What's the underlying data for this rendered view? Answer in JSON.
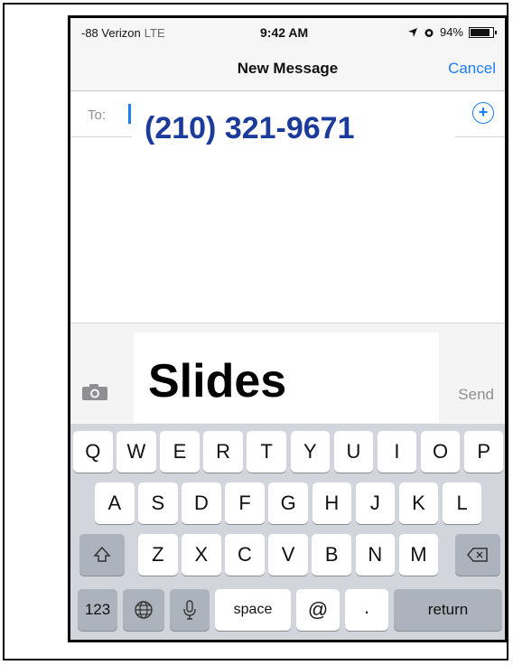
{
  "status": {
    "carrier": "-88 Verizon",
    "network": "LTE",
    "time": "9:42 AM",
    "battery": "94%",
    "battery_level": 0.94
  },
  "nav": {
    "title": "New Message",
    "cancel": "Cancel"
  },
  "to": {
    "label": "To:",
    "recipient": "(210) 321-9671"
  },
  "compose": {
    "message": "Slides",
    "send": "Send"
  },
  "keyboard": {
    "row1": [
      "Q",
      "W",
      "E",
      "R",
      "T",
      "Y",
      "U",
      "I",
      "O",
      "P"
    ],
    "row2": [
      "A",
      "S",
      "D",
      "F",
      "G",
      "H",
      "J",
      "K",
      "L"
    ],
    "row3": [
      "Z",
      "X",
      "C",
      "V",
      "B",
      "N",
      "M"
    ],
    "numbers": "123",
    "space": "space",
    "at": "@",
    "period": ".",
    "return": "return"
  },
  "colors": {
    "accent": "#1a7ef5",
    "phone_text": "#1b3c9b"
  },
  "icons": [
    "location-arrow-icon",
    "alarm-icon",
    "battery-icon",
    "add-contact-icon",
    "camera-icon",
    "shift-icon",
    "backspace-icon",
    "globe-icon",
    "microphone-icon"
  ]
}
